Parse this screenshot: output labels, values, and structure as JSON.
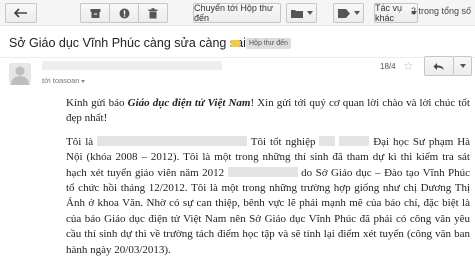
{
  "toolbar": {
    "archive_label": "Chuyển tới Hộp thư đến",
    "more_label": "Tác vụ khác",
    "pager": "2 trong tổng số"
  },
  "message": {
    "subject": "Sở Giáo dục Vĩnh Phúc càng sửa càng sai",
    "label": "Hộp thư đến",
    "to": "tới toasoan",
    "date": "18/4",
    "body": {
      "greeting_1": "Kính gửi báo ",
      "greeting_paper": "Giáo dục điện tử Việt Nam",
      "greeting_2": "! Xin gửi tới quý cơ quan lời chào và lời chúc tốt đẹp nhất!",
      "p2_a": "Tôi là",
      "p2_b": "Tôi tốt nghiệp",
      "p2_c": "Đại học Sư phạm Hà Nội (khóa 2008 – 2012). Tôi là một trong những thí sinh đã tham dự kì thi kiểm tra sát hạch xét tuyển  giáo viên năm 2012",
      "p2_d": "do Sở Giáo dục – Đào tạo Vĩnh Phúc tổ chức hồi tháng 12/2012. Tôi là một trong những trường hợp giống như chị Dương Thị Ánh ở khoa Văn. Nhờ có sự can thiệp, bênh vực lẽ phải mạnh mẽ của báo chí, đặc biệt là của báo Giáo dục điện tử Việt Nam nên Sở Giáo dục Vĩnh Phúc đã phải có công văn yêu cầu thí sinh dự thi về trường tách điểm học tập và sẽ tính lại điểm xét tuyển (công văn ban hành ngày 20/03/2013)."
    }
  }
}
